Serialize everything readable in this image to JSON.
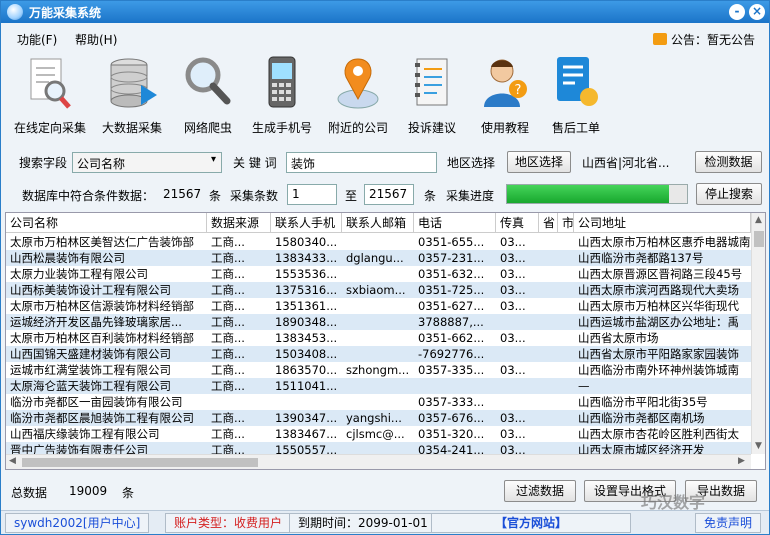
{
  "window": {
    "title": "万能采集系统",
    "minimize_label": "-",
    "close_label": "×"
  },
  "menu": {
    "items": [
      "功能(F)",
      "帮助(H)"
    ],
    "notice_label": "公告：",
    "notice_value": "暂无公告"
  },
  "toolbar": [
    {
      "label": "在线定向采集",
      "icon": "document-search-icon"
    },
    {
      "label": "大数据采集",
      "icon": "database-play-icon"
    },
    {
      "label": "网络爬虫",
      "icon": "magnifier-icon"
    },
    {
      "label": "生成手机号",
      "icon": "mobile-phone-icon"
    },
    {
      "label": "附近的公司",
      "icon": "map-pin-icon"
    },
    {
      "label": "投诉建议",
      "icon": "notebook-icon"
    },
    {
      "label": "使用教程",
      "icon": "help-person-icon"
    },
    {
      "label": "售后工单",
      "icon": "ticket-sun-icon"
    }
  ],
  "search": {
    "field_label": "搜索字段",
    "field_value": "公司名称",
    "keyword_label": "关 键 词",
    "keyword_value": "装饰",
    "region_label": "地区选择",
    "region_button": "地区选择",
    "region_value": "山西省|河北省...",
    "detect_button": "检测数据"
  },
  "collect": {
    "match_label": "数据库中符合条件数据：",
    "match_count": "21567",
    "unit1": "条",
    "count_label": "采集条数",
    "from_value": "1",
    "to_label": "至",
    "to_value": "21567",
    "unit2": "条",
    "progress_label": "采集进度",
    "progress": 0.9,
    "stop_button": "停止搜索"
  },
  "table": {
    "columns": [
      "公司名称",
      "数据来源",
      "联系人手机",
      "联系人邮箱",
      "电话",
      "传真",
      "省",
      "市",
      "公司地址"
    ],
    "rows": [
      [
        "太原市万柏林区美智达仁广告装饰部",
        "工商...",
        "1580340...",
        "",
        "0351-655...",
        "03...",
        "",
        "",
        "山西太原市万柏林区惠乔电器城南"
      ],
      [
        "山西松晨装饰有限公司",
        "工商...",
        "1383433...",
        "dglangu...",
        "0357-231...",
        "03...",
        "",
        "",
        "山西临汾市尧都路137号"
      ],
      [
        "太原力业装饰工程有限公司",
        "工商...",
        "1553536...",
        "",
        "0351-632...",
        "03...",
        "",
        "",
        "山西太原晋源区晋祠路三段45号"
      ],
      [
        "山西标美装饰设计工程有限公司",
        "工商...",
        "1375316...",
        "sxbiaom...",
        "0351-725...",
        "03...",
        "",
        "",
        "山西太原市滨河西路现代大卖场"
      ],
      [
        "太原市万柏林区信源装饰材料经销部",
        "工商...",
        "1351361...",
        "",
        "0351-627...",
        "03...",
        "",
        "",
        "山西太原市万柏林区兴华街现代"
      ],
      [
        "运城经济开发区晶先锋玻璃家居...",
        "工商...",
        "1890348...",
        "",
        "3788887,...",
        "",
        "",
        "",
        "山西运城市盐湖区办公地址：禹"
      ],
      [
        "太原市万柏林区百利装饰材料经销部",
        "工商...",
        "1383453...",
        "",
        "0351-662...",
        "03...",
        "",
        "",
        "山西省太原市场"
      ],
      [
        "山西国锦天盛建材装饰有限公司",
        "工商...",
        "1503408...",
        "",
        "-7692776...",
        "",
        "",
        "",
        "山西省太原市平阳路家家园装饰"
      ],
      [
        "运城市红满堂装饰工程有限公司",
        "工商...",
        "1863570...",
        "szhongm...",
        "0357-335...",
        "03...",
        "",
        "",
        "山西临汾市南外环神州装饰城南"
      ],
      [
        "太原海仑蓝天装饰工程有限公司",
        "工商...",
        "1511041...",
        "",
        "",
        "",
        "",
        "",
        "—"
      ],
      [
        "临汾市尧都区一亩园装饰有限公司",
        "",
        "",
        "",
        "0357-333...",
        "",
        "",
        "",
        "山西临汾市平阳北街35号"
      ],
      [
        "临汾市尧都区晨旭装饰工程有限公司",
        "工商...",
        "1390347...",
        "yangshi...",
        "0357-676...",
        "03...",
        "",
        "",
        "山西临汾市尧都区南机场"
      ],
      [
        "山西福庆缘装饰工程有限公司",
        "工商...",
        "1383467...",
        "cjlsmc@...",
        "0351-320...",
        "03...",
        "",
        "",
        "山西太原市杏花岭区胜利西街太"
      ],
      [
        "晋中广告装饰有限责任公司",
        "工商...",
        "1550557...",
        "",
        "0354-241...",
        "03...",
        "",
        "",
        "山西太原市城区经济开发"
      ]
    ]
  },
  "footer": {
    "total_label": "总数据",
    "total_value": "19009",
    "unit": "条",
    "filter_button": "过滤数据",
    "export_format_button": "设置导出格式",
    "export_button": "导出数据",
    "watermark": "巧汉数字"
  },
  "status": {
    "user": "sywdh2002[用户中心]",
    "account": "账户类型：收费用户",
    "expire": "到期时间：2099-01-01",
    "site": "【官方网站】",
    "disclaimer": "免责声明"
  },
  "colors": {
    "titlebar": "#1b74c8",
    "accent_red": "#d42020",
    "link_blue": "#1b4fd8",
    "progress": "#18a82e"
  }
}
